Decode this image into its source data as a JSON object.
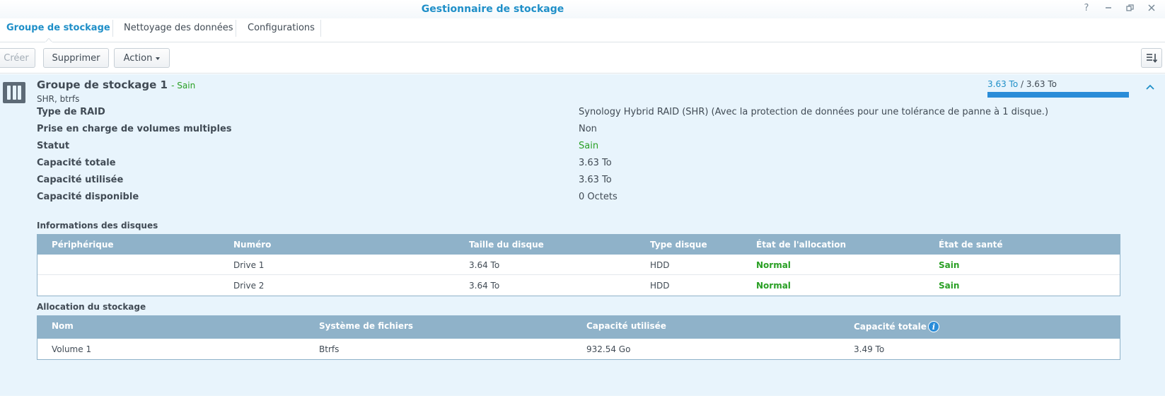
{
  "window": {
    "title": "Gestionnaire de stockage"
  },
  "tabs": [
    {
      "label": "Groupe de stockage"
    },
    {
      "label": "Nettoyage des données"
    },
    {
      "label": "Configurations"
    }
  ],
  "toolbar": {
    "create_label": "Créer",
    "delete_label": "Supprimer",
    "action_label": "Action"
  },
  "pool": {
    "name": "Groupe de stockage 1",
    "status_suffix": "- Sain",
    "subtitle": "SHR, btrfs",
    "capacity_used": "3.63 To",
    "capacity_separator": " / ",
    "capacity_total": "3.63 To",
    "usage_fraction": 1.0,
    "properties": [
      {
        "label": "Type de RAID",
        "value": "Synology Hybrid RAID (SHR) (Avec la protection de données pour une tolérance de panne à 1 disque.)"
      },
      {
        "label": "Prise en charge de volumes multiples",
        "value": "Non"
      },
      {
        "label": "Statut",
        "value": "Sain"
      },
      {
        "label": "Capacité totale",
        "value": "3.63 To"
      },
      {
        "label": "Capacité utilisée",
        "value": "3.63 To"
      },
      {
        "label": "Capacité disponible",
        "value": "0 Octets"
      }
    ]
  },
  "disks": {
    "title": "Informations des disques",
    "columns": [
      "Périphérique",
      "Numéro",
      "Taille du disque",
      "Type disque",
      "État de l'allocation",
      "État de santé"
    ],
    "rows": [
      [
        "",
        "Drive 1",
        "3.64 To",
        "HDD",
        "Normal",
        "Sain"
      ],
      [
        "",
        "Drive 2",
        "3.64 To",
        "HDD",
        "Normal",
        "Sain"
      ]
    ]
  },
  "allocation": {
    "title": "Allocation du stockage",
    "columns": [
      "Nom",
      "Système de fichiers",
      "Capacité utilisée",
      "Capacité totale"
    ],
    "rows": [
      [
        "Volume 1",
        "Btrfs",
        "932.54 Go",
        "3.49 To"
      ]
    ]
  },
  "colors": {
    "accent": "#1f8fc8",
    "ok": "#2aa025",
    "panel_bg": "#e8f4fc",
    "table_header": "#8fb2c9"
  }
}
